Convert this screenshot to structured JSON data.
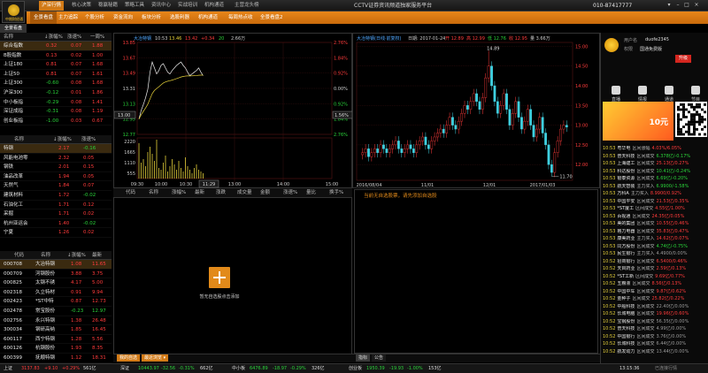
{
  "logo_text": "中期财经通",
  "top_tabs": [
    {
      "label": "沪深行情",
      "active": true
    },
    {
      "label": "核心决策"
    },
    {
      "label": "稳赢秘籍"
    },
    {
      "label": "策略工具"
    },
    {
      "label": "资讯中心"
    },
    {
      "label": "实战培训"
    },
    {
      "label": "机构通道"
    },
    {
      "label": "主营龙头榜"
    }
  ],
  "top_title": "CCTV证券资讯频道独家服务平台",
  "phone": "010-87417777",
  "window_controls": [
    "▾",
    "–",
    "□",
    "×"
  ],
  "sub_tabs": [
    "全景看盘",
    "主力追踪",
    "个股分析",
    "资金流向",
    "板块分析",
    "选股利器",
    "机构通道",
    "每周热点收",
    "全景看盘2"
  ],
  "section_label": "全景看盘",
  "index_table": {
    "headers": [
      "名称",
      "↓涨幅%",
      "涨速%",
      "一周%"
    ],
    "rows": [
      {
        "name": "综合指数",
        "v1": "0.32",
        "v2": "0.07",
        "v3": "1.88",
        "c1": "red",
        "c2": "red",
        "c3": "red",
        "sel": true
      },
      {
        "name": "B股指数",
        "v1": "0.13",
        "v2": "0.02",
        "v3": "1.00",
        "c1": "red",
        "c2": "red",
        "c3": "red"
      },
      {
        "name": "上证180",
        "v1": "0.81",
        "v2": "0.07",
        "v3": "1.68",
        "c1": "red",
        "c2": "red",
        "c3": "red"
      },
      {
        "name": "上证50",
        "v1": "0.81",
        "v2": "0.07",
        "v3": "1.61",
        "c1": "red",
        "c2": "red",
        "c3": "red"
      },
      {
        "name": "上证300",
        "v1": "-0.60",
        "v2": "0.08",
        "v3": "1.68",
        "c1": "green",
        "c2": "red",
        "c3": "red"
      },
      {
        "name": "沪深300",
        "v1": "-0.12",
        "v2": "0.01",
        "v3": "1.86",
        "c1": "green",
        "c2": "red",
        "c3": "red"
      },
      {
        "name": "中小板指",
        "v1": "-0.29",
        "v2": "0.08",
        "v3": "1.41",
        "c1": "green",
        "c2": "red",
        "c3": "red"
      },
      {
        "name": "深证成指",
        "v1": "-0.31",
        "v2": "0.08",
        "v3": "1.19",
        "c1": "green",
        "c2": "red",
        "c3": "red"
      },
      {
        "name": "创业板指",
        "v1": "-1.00",
        "v2": "0.03",
        "v3": "0.67",
        "c1": "green",
        "c2": "red",
        "c3": "red"
      }
    ]
  },
  "sector_table": {
    "headers": [
      "名称",
      "↓涨幅%",
      "涨速%"
    ],
    "rows": [
      {
        "name": "特钢",
        "v1": "2.17",
        "v2": "-0.16",
        "c1": "red",
        "c2": "green",
        "sel": true
      },
      {
        "name": "风能电池零",
        "v1": "2.32",
        "v2": "0.05",
        "c1": "red",
        "c2": "red"
      },
      {
        "name": "钢铁",
        "v1": "2.01",
        "v2": "0.15",
        "c1": "red",
        "c2": "red"
      },
      {
        "name": "油品改革",
        "v1": "1.94",
        "v2": "0.05",
        "c1": "red",
        "c2": "red"
      },
      {
        "name": "天然气",
        "v1": "1.84",
        "v2": "0.07",
        "c1": "red",
        "c2": "red"
      },
      {
        "name": "建筑材料",
        "v1": "1.72",
        "v2": "-0.02",
        "c1": "red",
        "c2": "green"
      },
      {
        "name": "石油化工",
        "v1": "1.71",
        "v2": "0.12",
        "c1": "red",
        "c2": "red"
      },
      {
        "name": "采掘",
        "v1": "1.71",
        "v2": "0.02",
        "c1": "red",
        "c2": "red"
      },
      {
        "name": "杭州亚运会",
        "v1": "1.40",
        "v2": "-0.02",
        "c1": "red",
        "c2": "green"
      },
      {
        "name": "宁夏",
        "v1": "1.26",
        "v2": "0.02",
        "c1": "red",
        "c2": "red"
      }
    ]
  },
  "stock_table": {
    "headers": [
      "代码",
      "名称",
      "↓涨幅%",
      "最新"
    ],
    "rows": [
      {
        "code": "000708",
        "name": "大冶特钢",
        "v1": "1.08",
        "v2": "11.65",
        "c": "red",
        "sel": true
      },
      {
        "code": "000709",
        "name": "河钢股份",
        "v1": "3.88",
        "v2": "3.75",
        "c": "red"
      },
      {
        "code": "000825",
        "name": "太钢不锈",
        "v1": "4.17",
        "v2": "5.00",
        "c": "red"
      },
      {
        "code": "002318",
        "name": "久立特材",
        "v1": "0.91",
        "v2": "9.94",
        "c": "red"
      },
      {
        "code": "002423",
        "name": "*ST中特",
        "v1": "0.87",
        "v2": "12.73",
        "c": "red"
      },
      {
        "code": "002478",
        "name": "常宝股份",
        "v1": "-0.23",
        "v2": "12.97",
        "c": "green"
      },
      {
        "code": "002756",
        "name": "永兴特钢",
        "v1": "1.38",
        "v2": "26.48",
        "c": "red"
      },
      {
        "code": "300034",
        "name": "钢研高纳",
        "v1": "1.85",
        "v2": "16.45",
        "c": "red"
      },
      {
        "code": "600117",
        "name": "西宁特钢",
        "v1": "1.28",
        "v2": "5.56",
        "c": "red"
      },
      {
        "code": "600126",
        "name": "杭钢股份",
        "v1": "1.93",
        "v2": "8.35",
        "c": "red"
      },
      {
        "code": "600399",
        "name": "抚顺特钢",
        "v1": "1.12",
        "v2": "18.31",
        "c": "red"
      }
    ]
  },
  "intraday": {
    "title": "大冶特钢",
    "time": "10:53",
    "price_label": "13.46",
    "avg_label": "13.42",
    "change_label": "+0.34",
    "vol_label": "20",
    "amount_label": "2.66万",
    "y_left": [
      "13.85",
      "13.67",
      "13.49",
      "13.31",
      "13.13",
      "12.95",
      "12.77"
    ],
    "y_right": [
      "2.76%",
      "1.84%",
      "0.92%",
      "0.00%",
      "0.92%",
      "1.84%",
      "2.76%"
    ],
    "left_box": "13.00",
    "right_box": "1.56%",
    "vol_axis": [
      "2220",
      "1665",
      "1110",
      "555"
    ],
    "x_labels": [
      "09:30",
      "10:00",
      "10:30",
      "11:00",
      "13:00",
      "14:00",
      "15:00"
    ],
    "cursor_time": "11:29"
  },
  "kline": {
    "title": "大冶特钢(日线·前复权)",
    "date": "日期: 2017-01-24",
    "open_label": "开 12.89",
    "high_label": "高 12.99",
    "low_label": "低 12.76",
    "close_label": "收 12.95",
    "vol_label": "量 3.66万",
    "high_mark": "14.89",
    "low_mark": "11.70",
    "y_right": [
      "15.00",
      "14.50",
      "14.00",
      "13.50",
      "13.00",
      "12.50",
      "12.00"
    ],
    "x_labels": [
      "2016/08/04",
      "11/01",
      "12/01",
      "2017/01/03"
    ]
  },
  "watchlist": {
    "headers": [
      "代码",
      "名称",
      "涨幅%",
      "最新",
      "涨跌",
      "成交量",
      "金额",
      "涨速%",
      "量比",
      "换手%"
    ],
    "empty_note": "暂无自选股点击添加",
    "hint": "当前无自选股票，请先添加自选股"
  },
  "right_panel": {
    "account_label": "用户名",
    "account_value": "duofe2345",
    "level_label": "权限",
    "level_value": "国通免费版",
    "upgrade": "升级",
    "actions": [
      "直播",
      "情报",
      "通道",
      "节目"
    ],
    "banner_text": "10元",
    "news": [
      {
        "time": "10:53",
        "name": "粤华电",
        "tag": "区间涨幅",
        "val": "4.03%/6.05%",
        "c": "red"
      },
      {
        "time": "10:53",
        "name": "普天科技",
        "tag": "区间成交",
        "val": "6.378亿/-0.17%",
        "c": "green"
      },
      {
        "time": "10:53",
        "name": "上海建工",
        "tag": "区间成交",
        "val": "25.13亿/0.27%",
        "c": "red"
      },
      {
        "time": "10:53",
        "name": "科达股份",
        "tag": "区间成交",
        "val": "10.41亿/-0.24%",
        "c": "green"
      },
      {
        "time": "10:53",
        "name": "银泰资源",
        "tag": "区间成交",
        "val": "6.69亿/-0.20%",
        "c": "green"
      },
      {
        "time": "10:53",
        "name": "航天智装",
        "tag": "主力买入",
        "val": "6.9900/-1.58%",
        "c": "green"
      },
      {
        "time": "10:53",
        "name": "万科A",
        "tag": "主力买入",
        "val": "8.9900/0.92%",
        "c": "red"
      },
      {
        "time": "10:53",
        "name": "中国平安",
        "tag": "区间成交",
        "val": "21.53亿/0.35%",
        "c": "red"
      },
      {
        "time": "10:53",
        "name": "*ST厦工",
        "tag": "区间成交",
        "val": "4.55亿/1.00%",
        "c": "red"
      },
      {
        "time": "10:53",
        "name": "百视通",
        "tag": "区间成交",
        "val": "24.35亿/0.05%",
        "c": "red"
      },
      {
        "time": "10:53",
        "name": "美的集团",
        "tag": "区间成交",
        "val": "10.55亿/0.46%",
        "c": "red"
      },
      {
        "time": "10:53",
        "name": "格力电器",
        "tag": "区间成交",
        "val": "35.83亿/0.47%",
        "c": "red"
      },
      {
        "time": "10:53",
        "name": "康美药业",
        "tag": "主力买入",
        "val": "14.62亿/0.07%",
        "c": "red"
      },
      {
        "time": "10:53",
        "name": "同方股份",
        "tag": "区间成交",
        "val": "4.74亿/-0.75%",
        "c": "green"
      },
      {
        "time": "10:53",
        "name": "民生银行",
        "tag": "主力买入",
        "val": "4.4900/0.00%",
        "c": "gray"
      },
      {
        "time": "10:52",
        "name": "招商银行",
        "tag": "区间成交",
        "val": "6.5400/0.46%",
        "c": "red"
      },
      {
        "time": "10:52",
        "name": "天目药业",
        "tag": "区间成交",
        "val": "2.59亿/0.13%",
        "c": "red"
      },
      {
        "time": "10:52",
        "name": "*ST工新",
        "tag": "区间成交",
        "val": "9.69亿/0.77%",
        "c": "red"
      },
      {
        "time": "10:52",
        "name": "五粮液",
        "tag": "区间成交",
        "val": "8.56亿/0.13%",
        "c": "red"
      },
      {
        "time": "10:52",
        "name": "中国中车",
        "tag": "区间成交",
        "val": "9.87亿/0.62%",
        "c": "red"
      },
      {
        "time": "10:52",
        "name": "金种子",
        "tag": "区间成交",
        "val": "25.82亿/0.22%",
        "c": "red"
      },
      {
        "time": "10:52",
        "name": "中船科技",
        "tag": "区间成交",
        "val": "22.40亿/0.00%",
        "c": "gray"
      },
      {
        "time": "10:52",
        "name": "长城电脑",
        "tag": "区间成交",
        "val": "19.96亿/0.60%",
        "c": "red"
      },
      {
        "time": "10:52",
        "name": "宝钢股份",
        "tag": "区间成交",
        "val": "56.35亿/0.00%",
        "c": "gray"
      },
      {
        "time": "10:52",
        "name": "普天科技",
        "tag": "区间成交",
        "val": "4.99亿/0.00%",
        "c": "gray"
      },
      {
        "time": "10:52",
        "name": "中国银行",
        "tag": "区间成交",
        "val": "3.76亿/0.00%",
        "c": "gray"
      },
      {
        "time": "10:52",
        "name": "长城科技",
        "tag": "区间成交",
        "val": "6.44亿/0.00%",
        "c": "gray"
      },
      {
        "time": "10:52",
        "name": "航发动力",
        "tag": "区间成交",
        "val": "13.44亿/0.00%",
        "c": "gray"
      }
    ]
  },
  "bottom_tabs": [
    {
      "label": "我的自选",
      "active": true
    },
    {
      "label": "最近浏览 ▾",
      "active": true
    }
  ],
  "kline_tabs": [
    "指标",
    "公告"
  ],
  "status": [
    {
      "label": "上证",
      "value": "3137.83",
      "ch": "+9.10",
      "pct": "+0.29%",
      "amt": "561亿",
      "c": "red"
    },
    {
      "label": "深证",
      "value": "10443.97",
      "ch": "-32.56",
      "pct": "-0.31%",
      "amt": "662亿",
      "c": "green"
    },
    {
      "label": "中小板",
      "value": "6476.89",
      "ch": "-18.97",
      "pct": "-0.29%",
      "amt": "326亿",
      "c": "green"
    },
    {
      "label": "创业板",
      "value": "1950.39",
      "ch": "-19.93",
      "pct": "-1.00%",
      "amt": "153亿",
      "c": "green"
    }
  ],
  "status_right": "13:15:36",
  "status_conn": "已连接行情"
}
